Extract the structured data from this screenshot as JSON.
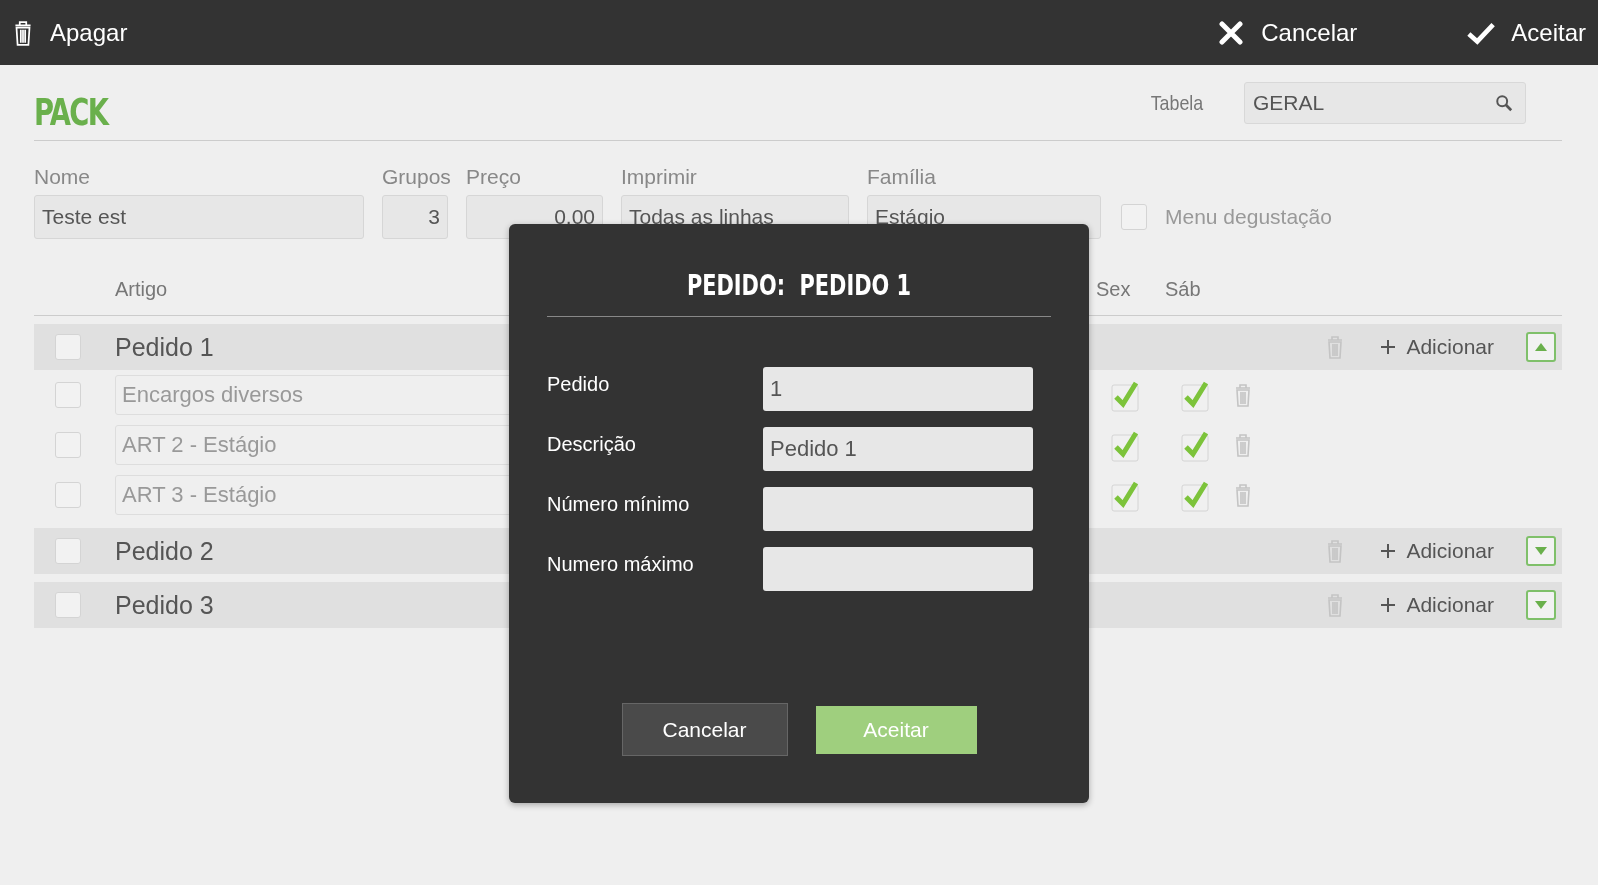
{
  "toolbar": {
    "delete": "Apagar",
    "cancel": "Cancelar",
    "accept": "Aceitar"
  },
  "header": {
    "title": "PACK",
    "table_label": "Tabela",
    "table_value": "GERAL"
  },
  "form": {
    "fields": [
      {
        "label": "Nome",
        "value": "Teste est",
        "kind": "text"
      },
      {
        "label": "Grupos",
        "value": "3",
        "kind": "number"
      },
      {
        "label": "Preço",
        "value": "0.00",
        "kind": "number"
      },
      {
        "label": "Imprimir",
        "value": "Todas as linhas",
        "kind": "text"
      },
      {
        "label": "Família",
        "value": "Estágio",
        "kind": "text"
      }
    ],
    "option": {
      "label": "Menu degustação",
      "checked": false
    }
  },
  "table": {
    "columns": [
      {
        "label": "Artigo"
      },
      {
        "label": "Sex"
      },
      {
        "label": "Sáb"
      }
    ],
    "groups": [
      {
        "name": "Pedido 1",
        "checked": false,
        "expanded": true,
        "add_label": "Adicionar",
        "items": [
          {
            "name": "Encargos diversos",
            "checked": false,
            "sex": true,
            "sab": true
          },
          {
            "name": "ART 2 - Estágio",
            "checked": false,
            "sex": true,
            "sab": true
          },
          {
            "name": "ART 3 - Estágio",
            "checked": false,
            "sex": true,
            "sab": true
          }
        ]
      },
      {
        "name": "Pedido 2",
        "checked": false,
        "expanded": false,
        "add_label": "Adicionar"
      },
      {
        "name": "Pedido 3",
        "checked": false,
        "expanded": false,
        "add_label": "Adicionar"
      }
    ]
  },
  "dialog": {
    "title": "PEDIDO:  PEDIDO 1",
    "fields": [
      {
        "label": "Pedido",
        "value": "1"
      },
      {
        "label": "Descrição",
        "value": "Pedido 1"
      },
      {
        "label": "Número mínimo"
      },
      {
        "label": "Numero máximo"
      }
    ],
    "cancel": "Cancelar",
    "accept": "Aceitar"
  }
}
